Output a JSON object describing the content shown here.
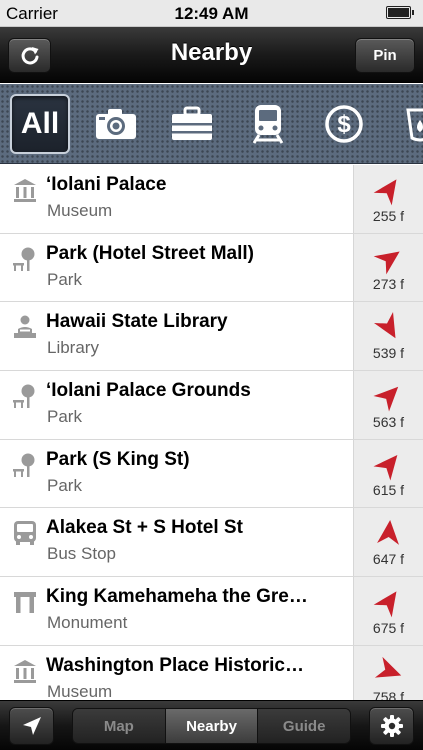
{
  "status": {
    "carrier": "Carrier",
    "time": "12:49 AM"
  },
  "nav": {
    "title": "Nearby",
    "pin_label": "Pin"
  },
  "categories": {
    "all_label": "All"
  },
  "places": [
    {
      "name": "‘Iolani Palace",
      "category": "Museum",
      "distance": "255 f",
      "icon": "museum-icon",
      "bearing": 35
    },
    {
      "name": "Park (Hotel Street Mall)",
      "category": "Park",
      "distance": "273 f",
      "icon": "park-icon",
      "bearing": 55
    },
    {
      "name": "Hawaii State Library",
      "category": "Library",
      "distance": "539 f",
      "icon": "library-icon",
      "bearing": 150
    },
    {
      "name": "‘Iolani Palace Grounds",
      "category": "Park",
      "distance": "563 f",
      "icon": "park-icon",
      "bearing": 45
    },
    {
      "name": "Park (S King St)",
      "category": "Park",
      "distance": "615 f",
      "icon": "park-icon",
      "bearing": 40
    },
    {
      "name": "Alakea St + S Hotel St",
      "category": "Bus Stop",
      "distance": "647 f",
      "icon": "bus-icon",
      "bearing": 5
    },
    {
      "name": "King Kamehameha the Gre…",
      "category": "Monument",
      "distance": "675 f",
      "icon": "monument-icon",
      "bearing": 35
    },
    {
      "name": "Washington Place Historic…",
      "category": "Museum",
      "distance": "758 f",
      "icon": "museum-icon",
      "bearing": 110
    }
  ],
  "tabs": {
    "map": "Map",
    "nearby": "Nearby",
    "guide": "Guide"
  },
  "colors": {
    "arrow": "#c8202b",
    "nav_dark": "#1a1a1a",
    "category_strip": "#5c6b7e"
  }
}
